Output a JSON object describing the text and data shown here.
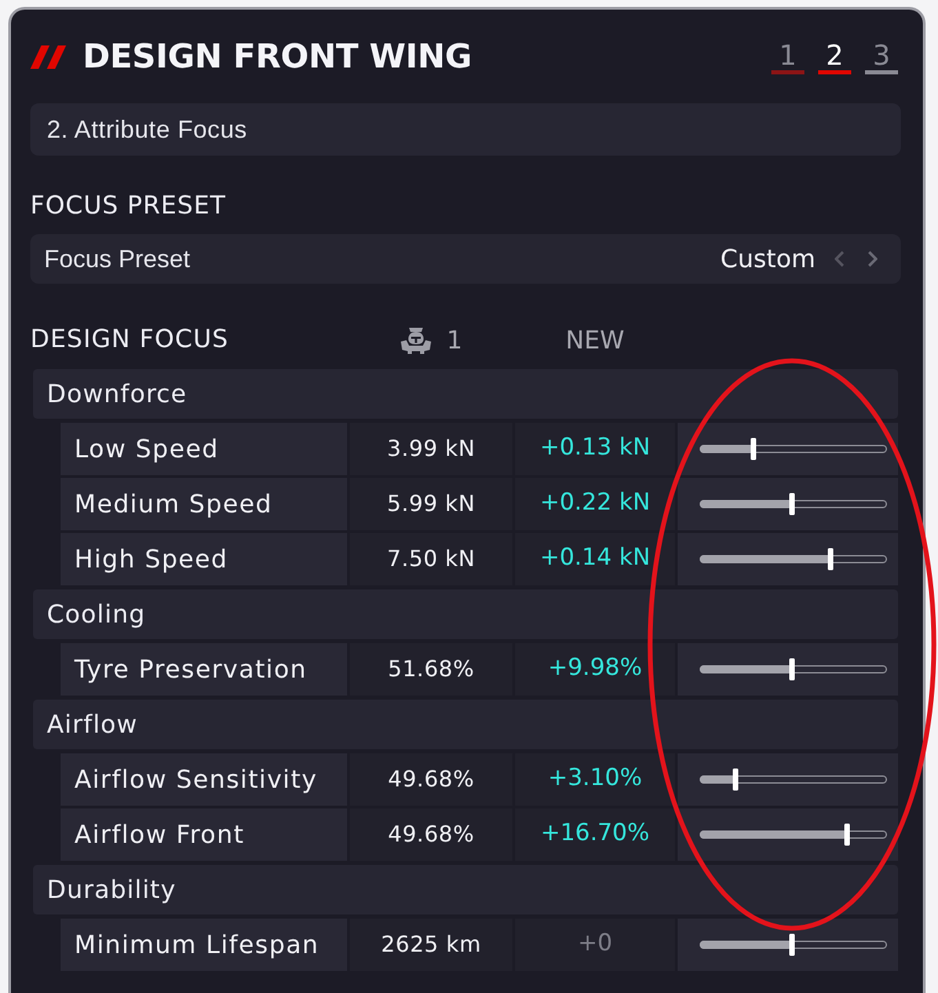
{
  "header": {
    "title": "DESIGN FRONT WING",
    "steps": [
      {
        "label": "1",
        "selected": false,
        "completed": true
      },
      {
        "label": "2",
        "selected": true,
        "completed": false
      },
      {
        "label": "3",
        "selected": false,
        "completed": false
      }
    ]
  },
  "section": {
    "title": "2. Attribute Focus"
  },
  "focus_preset": {
    "heading": "FOCUS PRESET",
    "label": "Focus Preset",
    "value": "Custom"
  },
  "design_focus": {
    "heading": "DESIGN FOCUS",
    "current_label": "1",
    "new_label": "NEW",
    "groups": [
      {
        "name": "Downforce",
        "attributes": [
          {
            "name": "Low Speed",
            "current": "3.99 kN",
            "new": "+0.13 kN",
            "changed": true,
            "level": 0.29
          },
          {
            "name": "Medium Speed",
            "current": "5.99 kN",
            "new": "+0.22 kN",
            "changed": true,
            "level": 0.49
          },
          {
            "name": "High Speed",
            "current": "7.50 kN",
            "new": "+0.14 kN",
            "changed": true,
            "level": 0.7
          }
        ]
      },
      {
        "name": "Cooling",
        "attributes": [
          {
            "name": "Tyre Preservation",
            "current": "51.68%",
            "new": "+9.98%",
            "changed": true,
            "level": 0.49
          }
        ]
      },
      {
        "name": "Airflow",
        "attributes": [
          {
            "name": "Airflow Sensitivity",
            "current": "49.68%",
            "new": "+3.10%",
            "changed": true,
            "level": 0.19
          },
          {
            "name": "Airflow Front",
            "current": "49.68%",
            "new": "+16.70%",
            "changed": true,
            "level": 0.79
          }
        ]
      },
      {
        "name": "Durability",
        "attributes": [
          {
            "name": "Minimum Lifespan",
            "current": "2625 km",
            "new": "+0",
            "changed": false,
            "level": 0.49
          }
        ]
      }
    ]
  },
  "annotations": [
    {
      "kind": "ellipse"
    }
  ]
}
